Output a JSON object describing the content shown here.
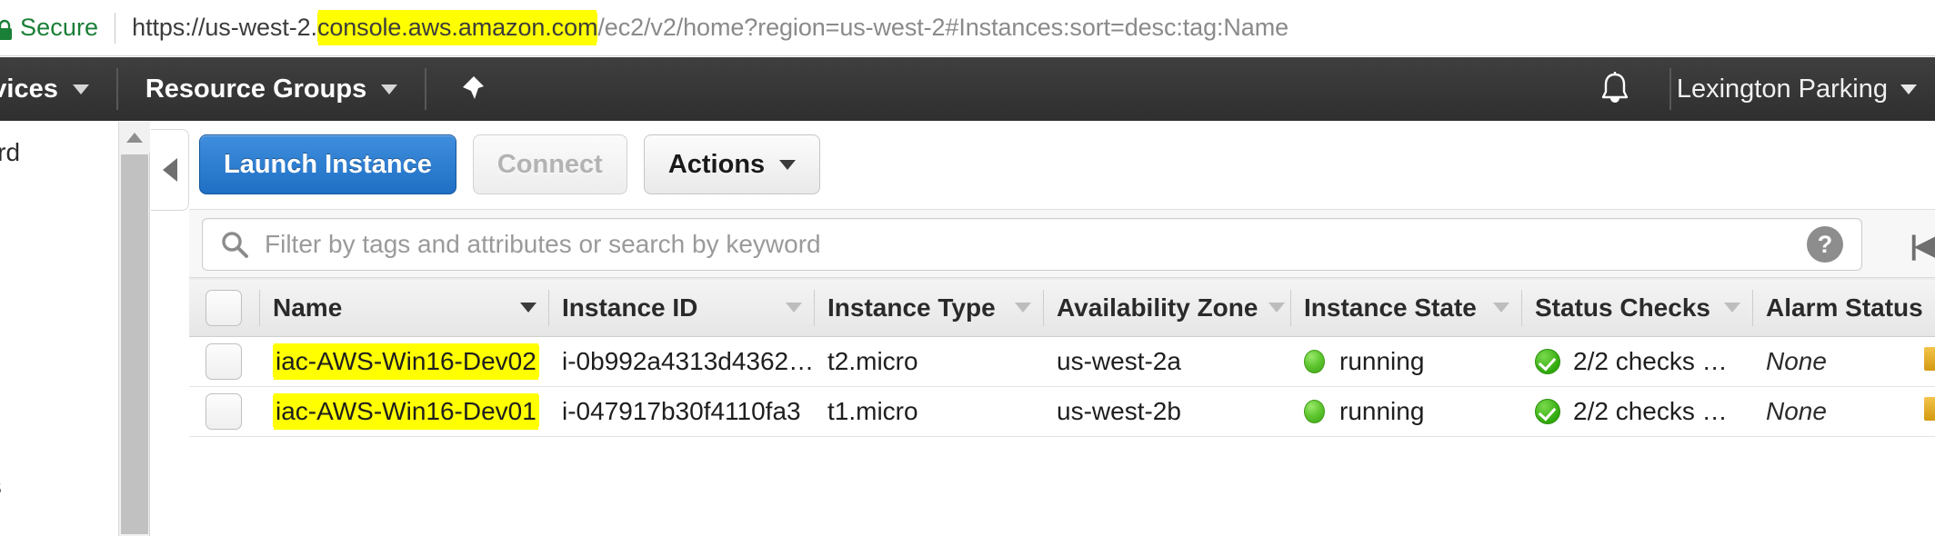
{
  "browser": {
    "security_label": "Secure",
    "lock_icon": "lock-icon",
    "url_parts": {
      "prefix": "https://us-west-2.",
      "highlighted_host": "console.aws.amazon.com",
      "suffix": "/ec2/v2/home?region=us-west-2#Instances:sort=desc:tag:Name"
    },
    "full_url": "https://us-west-2.console.aws.amazon.com/ec2/v2/home?region=us-west-2#Instances:sort=desc:tag:Name",
    "highlight_color": "#ffff00",
    "secure_color": "#1a7f37"
  },
  "awsnav": {
    "services_label": "rvices",
    "resource_groups_label": "Resource Groups",
    "pin_icon": "pin-icon",
    "bell_icon": "bell-icon",
    "account_label": "Lexington Parking",
    "caret_icon": "chevron-down-icon",
    "background_color": "#2f2f2f"
  },
  "leftnav": {
    "dashboard_label": "oard",
    "requests_label": "sts",
    "collapse_icon": "chevron-left-icon",
    "scroll_up_icon": "triangle-up-icon"
  },
  "toolbar": {
    "launch_label": "Launch Instance",
    "connect_label": "Connect",
    "actions_label": "Actions",
    "primary_color": "#1f6fc4"
  },
  "filter": {
    "search_icon": "search-icon",
    "placeholder": "Filter by tags and attributes or search by keyword",
    "value": "",
    "help_icon": "question-mark-icon",
    "help_label": "?",
    "pager_first_label": "|◀"
  },
  "table": {
    "columns": [
      {
        "label": "Name",
        "sortable": true,
        "active_sort": true
      },
      {
        "label": "Instance ID",
        "sortable": true,
        "active_sort": false
      },
      {
        "label": "Instance Type",
        "sortable": true,
        "active_sort": false
      },
      {
        "label": "Availability Zone",
        "sortable": true,
        "active_sort": false
      },
      {
        "label": "Instance State",
        "sortable": true,
        "active_sort": false
      },
      {
        "label": "Status Checks",
        "sortable": true,
        "active_sort": false
      },
      {
        "label": "Alarm Status",
        "sortable": false,
        "active_sort": false
      }
    ],
    "rows": [
      {
        "name": "iac-AWS-Win16-Dev02",
        "name_highlighted": true,
        "instance_id": "i-0b992a4313d4362…",
        "instance_type": "t2.micro",
        "availability_zone": "us-west-2a",
        "instance_state": "running",
        "state_icon": "green-dot-icon",
        "status_checks": "2/2 checks …",
        "status_icon": "green-check-icon",
        "alarm_status": "None"
      },
      {
        "name": "iac-AWS-Win16-Dev01",
        "name_highlighted": true,
        "instance_id": "i-047917b30f4110fa3",
        "instance_type": "t1.micro",
        "availability_zone": "us-west-2b",
        "instance_state": "running",
        "state_icon": "green-dot-icon",
        "status_checks": "2/2 checks …",
        "status_icon": "green-check-icon",
        "alarm_status": "None"
      }
    ]
  }
}
